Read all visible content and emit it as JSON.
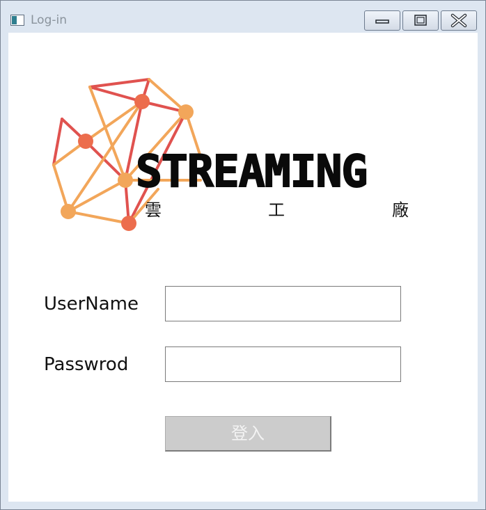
{
  "window": {
    "title": "Log-in",
    "controls": [
      "minimize-icon",
      "maximize-icon",
      "close-icon"
    ]
  },
  "logo": {
    "wordmark": "STREAMING",
    "sub_chars": [
      "雲",
      "工",
      "廠"
    ],
    "colors": {
      "red": "#e0524f",
      "orange": "#f2a65a",
      "coral": "#ec6d4d",
      "text": "#0a0a0a"
    }
  },
  "form": {
    "username_label": "UserName",
    "username_value": "",
    "password_label": "Passwrod",
    "password_value": "",
    "login_button": "登入"
  },
  "colors": {
    "window_frame": "#dde6f1",
    "button_disabled_bg": "#cccccc",
    "button_disabled_text": "#f3f3f3"
  }
}
